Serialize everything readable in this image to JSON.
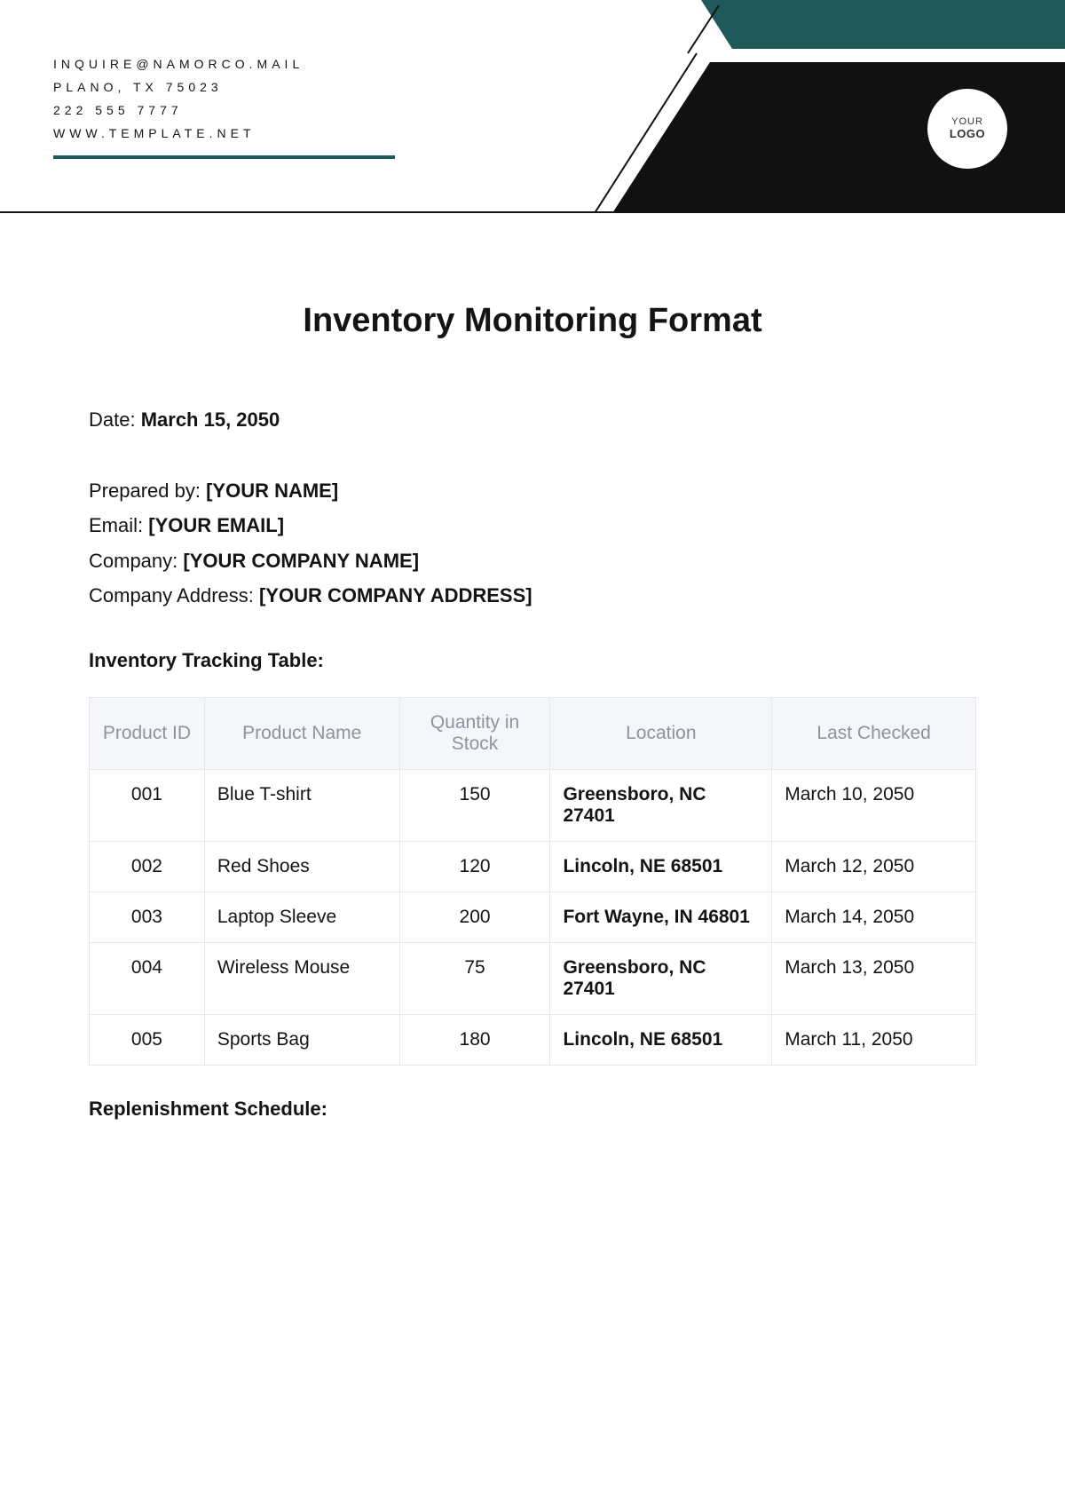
{
  "header": {
    "contact_lines": [
      "INQUIRE@NAMORCO.MAIL",
      "PLANO, TX 75023",
      "222 555 7777",
      "WWW.TEMPLATE.NET"
    ],
    "logo_line1": "YOUR",
    "logo_line2": "LOGO"
  },
  "title": "Inventory Monitoring Format",
  "meta": {
    "date_label": "Date: ",
    "date_value": "March 15, 2050",
    "prepared_by_label": "Prepared by: ",
    "prepared_by_value": "[YOUR NAME]",
    "email_label": "Email: ",
    "email_value": "[YOUR EMAIL]",
    "company_label": "Company: ",
    "company_value": "[YOUR COMPANY NAME]",
    "address_label": "Company Address: ",
    "address_value": "[YOUR COMPANY ADDRESS]"
  },
  "sections": {
    "inventory_label": "Inventory Tracking Table:",
    "replenishment_label": "Replenishment Schedule:"
  },
  "table": {
    "headers": {
      "c0": "Product ID",
      "c1": "Product Name",
      "c2": "Quantity in Stock",
      "c3": "Location",
      "c4": "Last Checked"
    },
    "rows": [
      {
        "id": "001",
        "name": "Blue T-shirt",
        "qty": "150",
        "loc": "Greensboro, NC 27401",
        "checked": "March 10, 2050"
      },
      {
        "id": "002",
        "name": "Red Shoes",
        "qty": "120",
        "loc": "Lincoln, NE 68501",
        "checked": "March 12, 2050"
      },
      {
        "id": "003",
        "name": "Laptop Sleeve",
        "qty": "200",
        "loc": "Fort Wayne, IN 46801",
        "checked": "March 14, 2050"
      },
      {
        "id": "004",
        "name": "Wireless Mouse",
        "qty": "75",
        "loc": "Greensboro, NC 27401",
        "checked": "March 13, 2050"
      },
      {
        "id": "005",
        "name": "Sports Bag",
        "qty": "180",
        "loc": "Lincoln, NE 68501",
        "checked": "March 11, 2050"
      }
    ]
  }
}
